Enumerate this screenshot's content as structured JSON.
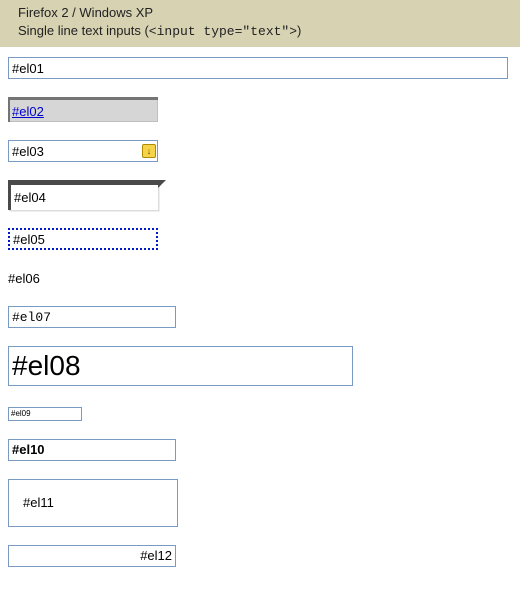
{
  "header": {
    "line1": "Firefox 2 / Windows XP",
    "line2_prefix": "Single line text inputs (",
    "line2_code": "<input type=\"text\">",
    "line2_suffix": ")"
  },
  "inputs": {
    "el01": "#el01",
    "el02": "#el02",
    "el03": "#el03",
    "el04": "#el04",
    "el05": "#el05",
    "el06": "#el06",
    "el07": "#el07",
    "el08": "#el08",
    "el09": "#el09",
    "el10": "#el10",
    "el11": "#el11",
    "el12": "#el12"
  },
  "icons": {
    "autofill_glyph": "↓"
  },
  "colors": {
    "header_bg": "#d6d2b2",
    "input_border": "#7a9ac6",
    "el02_text": "#0000cc",
    "el05_border": "#0018c8"
  }
}
